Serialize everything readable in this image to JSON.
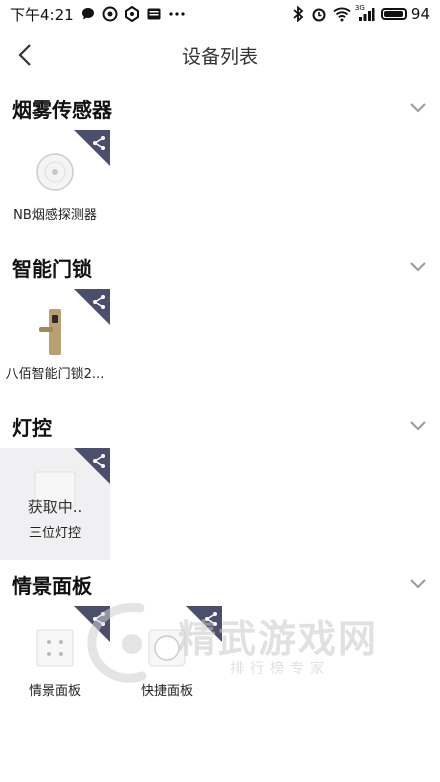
{
  "status_bar": {
    "time": "下午4:21",
    "signal_label": "3G",
    "battery": "94",
    "battery_level": 0.94
  },
  "nav": {
    "title": "设备列表"
  },
  "sections": [
    {
      "title": "烟雾传感器",
      "devices": [
        {
          "name": "NB烟感探测器"
        }
      ]
    },
    {
      "title": "智能门锁",
      "devices": [
        {
          "name": "八佰智能门锁2..."
        }
      ]
    },
    {
      "title": "灯控",
      "devices": [
        {
          "name": "三位灯控",
          "status": "获取中.."
        }
      ]
    },
    {
      "title": "情景面板",
      "devices": [
        {
          "name": "情景面板"
        },
        {
          "name": "快捷面板"
        }
      ]
    }
  ],
  "watermark": {
    "main": "精武游戏网",
    "sub": "排行榜专家"
  },
  "colors": {
    "badge": "#4a4f6b",
    "card_bg": "#f0f0f3"
  },
  "icons": [
    "message-icon",
    "share-icon",
    "chevron-down-icon",
    "back-icon",
    "bluetooth-icon",
    "alarm-icon",
    "wifi-icon",
    "signal-icon",
    "battery-icon"
  ]
}
